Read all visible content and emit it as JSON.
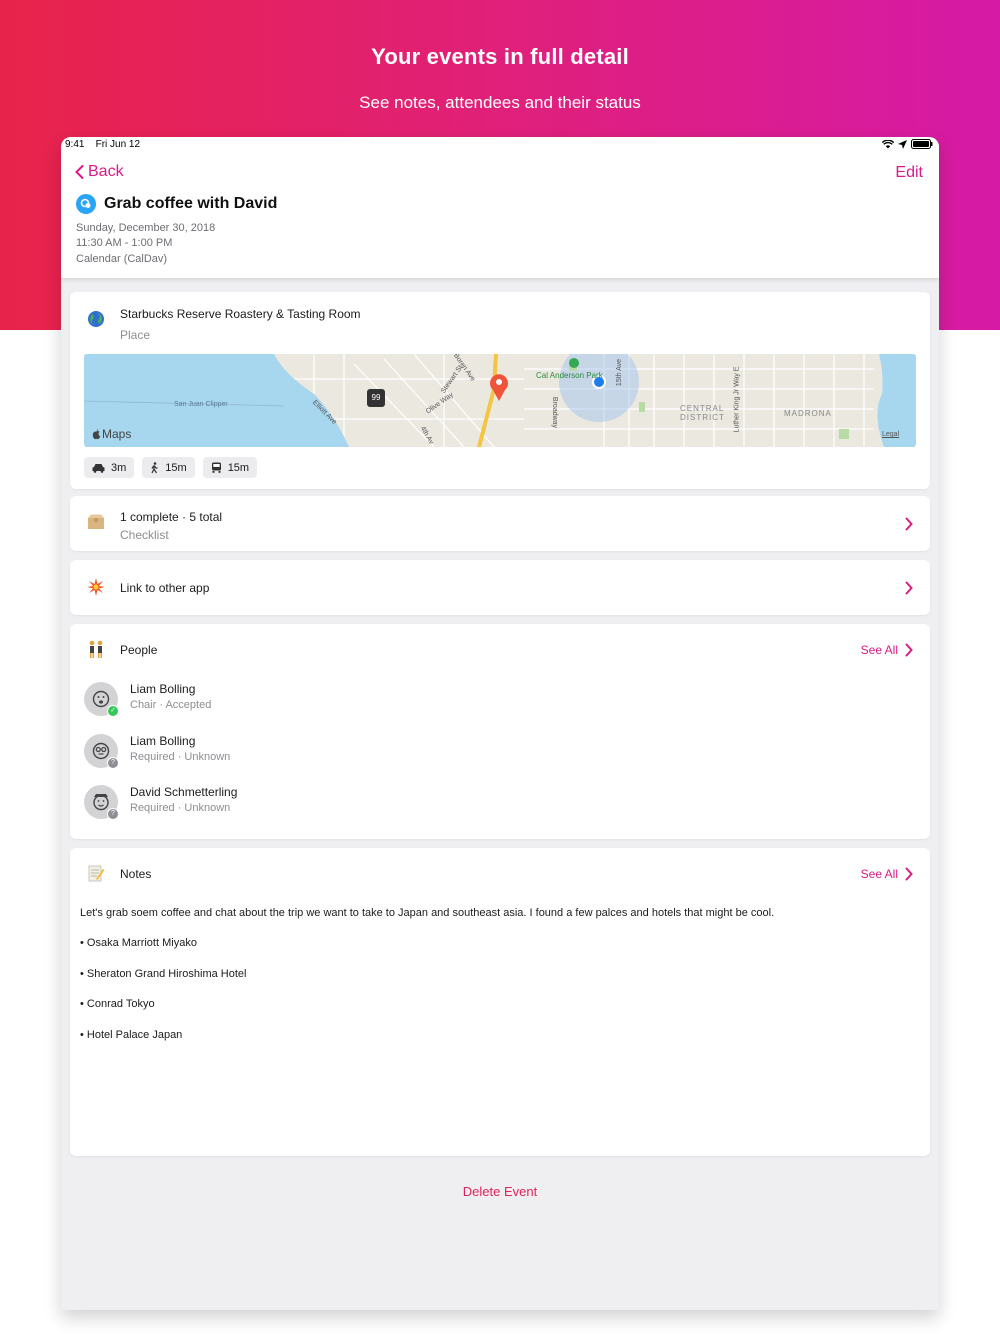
{
  "hero": {
    "title": "Your events in full detail",
    "subtitle": "See notes, attendees and their status"
  },
  "status_bar": {
    "time": "9:41",
    "date": "Fri Jun 12"
  },
  "nav": {
    "back_label": "Back",
    "edit_label": "Edit"
  },
  "event": {
    "title": "Grab coffee with David",
    "date": "Sunday, December 30, 2018",
    "time": "11:30 AM - 1:00 PM",
    "calendar": "Calendar (CalDav)"
  },
  "location": {
    "name": "Starbucks Reserve Roastery & Tasting Room",
    "type": "Place",
    "map_labels": {
      "maps_logo": "Maps",
      "legal": "Legal",
      "park": "Cal Anderson Park",
      "district1": "CENTRAL",
      "district2": "DISTRICT",
      "madrona": "MADRONA",
      "clipper": "San Juan Clipper",
      "elliott": "Elliott Ave",
      "stewart": "Stewart St",
      "olive": "Olive Way",
      "fourth": "4th Av",
      "broadway": "Broadway",
      "fifteenth": "15th Ave",
      "mlk": "Luther King Jr Way E",
      "boren": "Boren Ave",
      "shield": "99"
    },
    "travel": [
      {
        "mode": "car-icon",
        "label": "3m"
      },
      {
        "mode": "walk-icon",
        "label": "15m"
      },
      {
        "mode": "transit-icon",
        "label": "15m"
      }
    ]
  },
  "checklist": {
    "summary": "1 complete · 5 total",
    "label": "Checklist"
  },
  "link": {
    "label": "Link to other app"
  },
  "people": {
    "label": "People",
    "see_all": "See All",
    "items": [
      {
        "name": "Liam Bolling",
        "role": "Chair · Accepted",
        "status": "accepted"
      },
      {
        "name": "Liam Bolling",
        "role": "Required · Unknown",
        "status": "unknown"
      },
      {
        "name": "David Schmetterling",
        "role": "Required · Unknown",
        "status": "unknown"
      }
    ]
  },
  "notes": {
    "label": "Notes",
    "see_all": "See All",
    "body": "Let's grab soem coffee and chat about the trip we want to take to Japan and southeast asia. I found a few palces and hotels that might be cool.",
    "items": [
      "• Osaka Marriott Miyako",
      "• Sheraton Grand Hiroshima Hotel",
      "• Conrad Tokyo",
      "• Hotel Palace Japan"
    ]
  },
  "delete_label": "Delete Event",
  "colors": {
    "accent": "#d81b87",
    "destructive": "#e0235a",
    "accepted": "#34c759",
    "unknown": "#8e8e93"
  }
}
